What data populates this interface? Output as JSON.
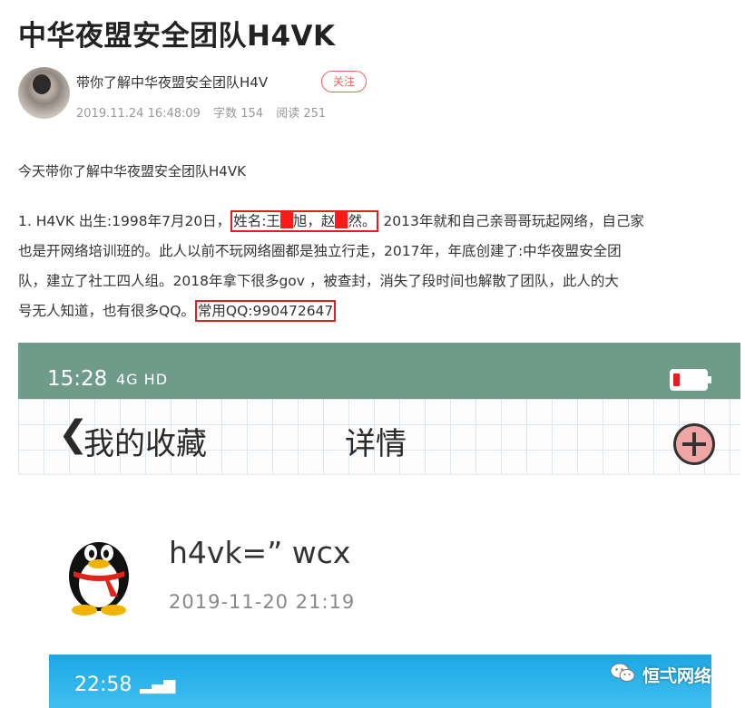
{
  "article": {
    "title": "中华夜盟安全团队H4VK",
    "author": {
      "name": "带你了解中华夜盟安全团队H4V",
      "follow_label": "关注"
    },
    "meta": {
      "date": "2019.11.24 16:48:09",
      "word_count": "字数 154",
      "reads": "阅读 251"
    },
    "intro": "今天带你了解中华夜盟安全团队H4VK",
    "paragraph": {
      "l1_prefix": "1. H4VK 出生:1998年7月20日，",
      "name_p1": "姓名:王",
      "name_p2": "旭，赵",
      "name_p3": "然。",
      "l1_suffix": "2013年就和自己亲哥哥玩起网络，自己家",
      "l2": "也是开网络培训班的。此人以前不玩网络圈都是独立行走，2017年，年底创建了:中华夜盟安全团",
      "l3": "队，建立了社工四人组。2018年拿下很多gov ，被查封，消失了段时间也解散了团队，此人的大",
      "l4_prefix": "号无人知道，也有很多QQ。",
      "qq": "常用QQ:990472647"
    }
  },
  "screenshot": {
    "status_time": "15:28",
    "status_signal": "4G  HD",
    "back_label": "我的收藏",
    "nav_title": "详情",
    "item_title": "h4vk=” wcx",
    "item_time": "2019-11-20 21:19",
    "status_time_2": "22:58",
    "colors": {
      "status_bar": "#6f9b8b",
      "battery_low": "#e02020",
      "plus_button": "#f0a6a4",
      "second_bar": "#1ba7e6"
    }
  },
  "watermark": {
    "text": "恒弌网络"
  },
  "icons": [
    "back-chevron-icon",
    "plus-icon",
    "qq-penguin-icon",
    "battery-icon",
    "signal-icon",
    "wechat-icon"
  ]
}
